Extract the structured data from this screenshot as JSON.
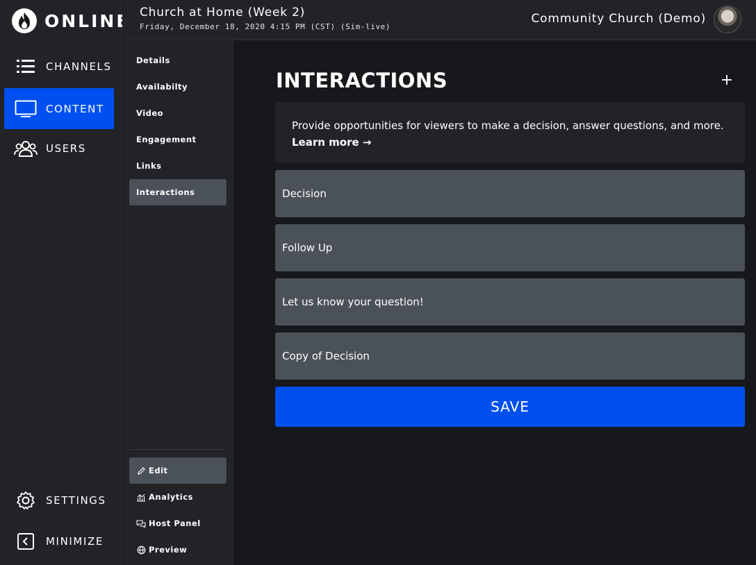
{
  "brand": {
    "name": "ONLINE",
    "accent": "#0050f0"
  },
  "leftnav": {
    "items": [
      {
        "label": "CHANNELS",
        "icon": "list-icon"
      },
      {
        "label": "CONTENT",
        "icon": "monitor-icon",
        "active": true
      },
      {
        "label": "USERS",
        "icon": "users-icon"
      }
    ],
    "bottom_items": [
      {
        "label": "SETTINGS",
        "icon": "gear-icon"
      },
      {
        "label": "MINIMIZE",
        "icon": "collapse-icon"
      }
    ]
  },
  "header": {
    "event_title": "Church at Home (Week 2)",
    "event_date": "Friday, December 18, 2020 4:15 PM (CST) (Sim-live)",
    "org_name": "Community Church (Demo)"
  },
  "subnav": {
    "items": [
      {
        "label": "Details"
      },
      {
        "label": "Availabilty"
      },
      {
        "label": "Video"
      },
      {
        "label": "Engagement"
      },
      {
        "label": "Links"
      },
      {
        "label": "Interactions",
        "active": true
      }
    ],
    "actions": [
      {
        "label": "Edit",
        "icon": "pencil-icon",
        "active": true
      },
      {
        "label": "Analytics",
        "icon": "analytics-icon"
      },
      {
        "label": "Host Panel",
        "icon": "chat-icon"
      },
      {
        "label": "Preview",
        "icon": "globe-icon"
      }
    ]
  },
  "main": {
    "heading": "INTERACTIONS",
    "add_label": "+",
    "info_text": "Provide opportunities for viewers to make a decision, answer questions, and more.",
    "learn_more": "Learn more →",
    "interactions": [
      {
        "title": "Decision"
      },
      {
        "title": "Follow Up"
      },
      {
        "title": "Let us know your question!"
      },
      {
        "title": "Copy of Decision"
      }
    ],
    "save_label": "SAVE"
  }
}
